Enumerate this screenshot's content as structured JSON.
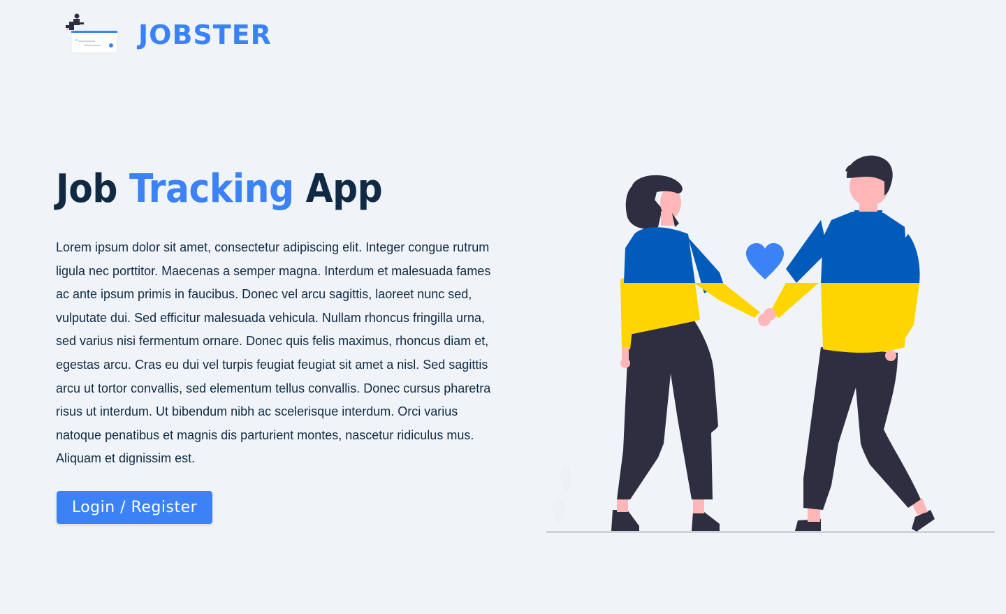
{
  "nav": {
    "logo_icon": "job-board-logo-icon",
    "brand": "JOBSTER"
  },
  "hero": {
    "title_part1": "Job ",
    "title_accent": "Tracking",
    "title_part2": " App",
    "description": "Lorem ipsum dolor sit amet, consectetur adipiscing elit. Integer congue rutrum ligula nec porttitor. Maecenas a semper magna. Interdum et malesuada fames ac ante ipsum primis in faucibus. Donec vel arcu sagittis, laoreet nunc sed, vulputate dui. Sed efficitur malesuada vehicula. Nullam rhoncus fringilla urna, sed varius nisi fermentum ornare. Donec quis felis maximus, rhoncus diam et, egestas arcu. Cras eu dui vel turpis feugiat feugiat sit amet a nisl. Sed sagittis arcu ut tortor convallis, sed elementum tellus convallis. Donec cursus pharetra risus ut interdum. Ut bibendum nibh ac scelerisque interdum. Orci varius natoque penatibus et magnis dis parturient montes, nascetur ridiculus mus. Aliquam et dignissim est.",
    "button_label": "Login / Register"
  },
  "illustration": {
    "icon": "couple-holding-hands-illustration"
  },
  "colors": {
    "background": "#f0f4f8",
    "primary": "#3b82f6",
    "heading": "#102a43",
    "sweater_blue": "#005bbb",
    "sweater_yellow": "#ffd500",
    "pants": "#2f2e41",
    "skin": "#ffb6b6"
  }
}
